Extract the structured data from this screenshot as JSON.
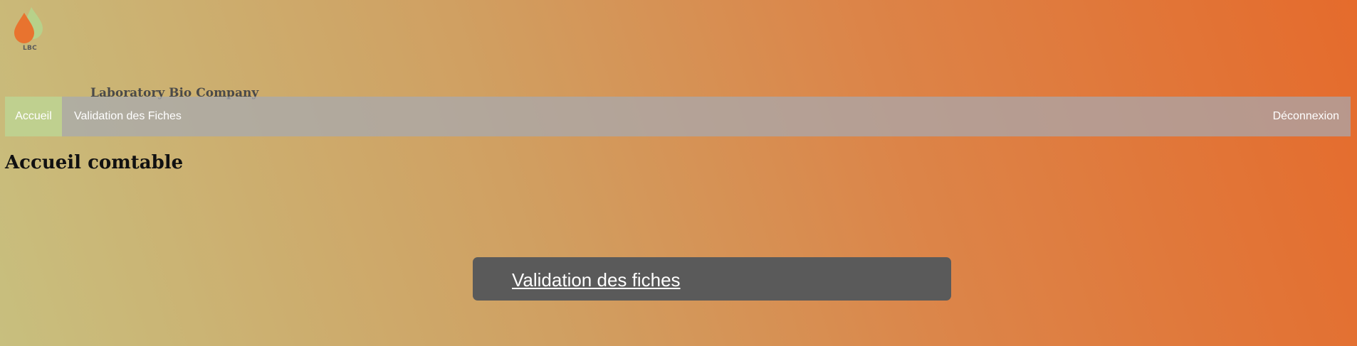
{
  "header": {
    "logo_text": "LBC",
    "company_name": "Laboratory Bio Company"
  },
  "navbar": {
    "items": [
      {
        "label": "Accueil",
        "active": true
      },
      {
        "label": "Validation des Fiches",
        "active": false
      }
    ],
    "logout_label": "Déconnexion"
  },
  "main": {
    "title": "Accueil comtable",
    "card_link_label": "Validation des fiches"
  },
  "colors": {
    "nav_active_bg": "#bfd08f",
    "card_bg": "#5a5a5a",
    "logo_orange": "#e8732f",
    "logo_green": "#b7d18a"
  }
}
